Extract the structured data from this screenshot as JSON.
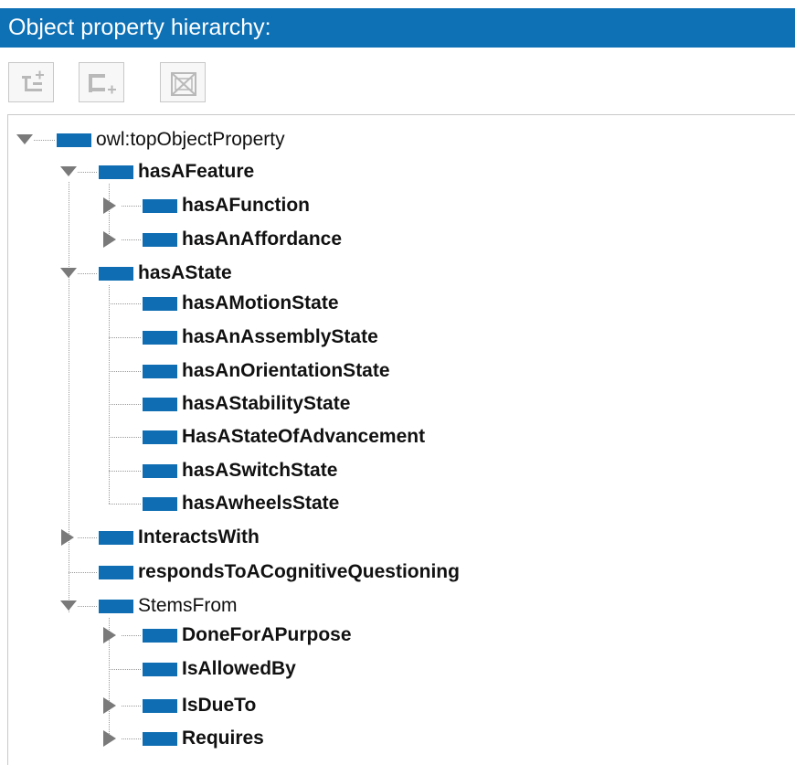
{
  "panel": {
    "title": "Object property hierarchy:"
  },
  "toolbar": {
    "buttons": [
      {
        "name": "add-sub-property-button",
        "icon": "add-sub-property-icon"
      },
      {
        "name": "add-sibling-property-button",
        "icon": "add-sibling-property-icon"
      },
      {
        "name": "delete-property-button",
        "icon": "delete-property-icon"
      }
    ]
  },
  "colors": {
    "header_bg": "#0f71b5",
    "property_icon": "#0f6eb3"
  },
  "tree": {
    "root": {
      "label": "owl:topObjectProperty",
      "expanded": true
    },
    "hasAFeature": {
      "label": "hasAFeature",
      "expanded": true
    },
    "hasAFunction": {
      "label": "hasAFunction",
      "expanded": false
    },
    "hasAnAffordance": {
      "label": "hasAnAffordance",
      "expanded": false
    },
    "hasAState": {
      "label": "hasAState",
      "expanded": true
    },
    "hasAMotionState": {
      "label": "hasAMotionState"
    },
    "hasAnAssemblyState": {
      "label": "hasAnAssemblyState"
    },
    "hasAnOrientationState": {
      "label": "hasAnOrientationState"
    },
    "hasAStabilityState": {
      "label": "hasAStabilityState"
    },
    "HasAStateOfAdvancement": {
      "label": "HasAStateOfAdvancement"
    },
    "hasASwitchState": {
      "label": "hasASwitchState"
    },
    "hasAwheelsState": {
      "label": "hasAwheelsState"
    },
    "InteractsWith": {
      "label": "InteractsWith",
      "expanded": false
    },
    "respondsToACognitiveQuestioning": {
      "label": "respondsToACognitiveQuestioning"
    },
    "StemsFrom": {
      "label": "StemsFrom",
      "expanded": true
    },
    "DoneForAPurpose": {
      "label": "DoneForAPurpose",
      "expanded": false
    },
    "IsAllowedBy": {
      "label": "IsAllowedBy"
    },
    "IsDueTo": {
      "label": "IsDueTo",
      "expanded": false
    },
    "Requires": {
      "label": "Requires",
      "expanded": false
    }
  }
}
